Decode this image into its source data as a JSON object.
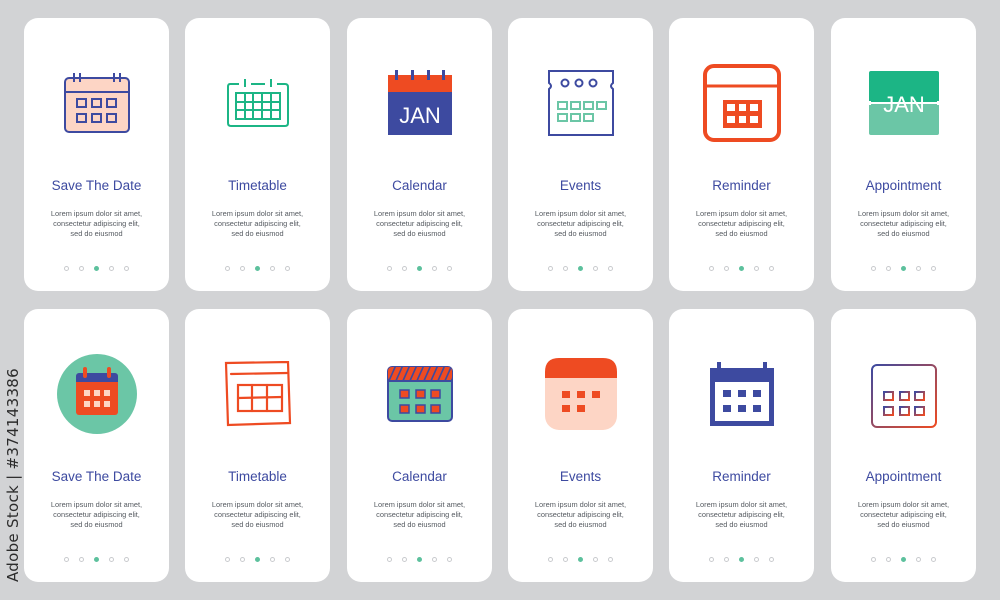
{
  "colors": {
    "background": "#d2d3d5",
    "card": "#ffffff",
    "title": "#3d4aa0",
    "text": "#555a60",
    "dot_active": "#5dc19d",
    "dot_inactive": "#c9cbce",
    "navy": "#3d4aa0",
    "orange": "#ee4b22",
    "green": "#1cb585",
    "mint": "#6bc6a6",
    "peach": "#fdd5c5"
  },
  "watermark": "Adobe Stock | #374143386",
  "description": [
    "Lorem ipsum dolor sit amet,",
    "consectetur adipiscing elit,",
    "sed do eiusmod"
  ],
  "pagination": {
    "total": 5,
    "active_index": 2
  },
  "rows": [
    {
      "cards": [
        {
          "title": "Save The Date",
          "icon": "calendar-outline-peach-icon"
        },
        {
          "title": "Timetable",
          "icon": "timetable-grid-outline-icon"
        },
        {
          "title": "Calendar",
          "icon": "calendar-jan-page-icon",
          "icon_text": "JAN"
        },
        {
          "title": "Events",
          "icon": "event-ticket-calendar-icon"
        },
        {
          "title": "Reminder",
          "icon": "reminder-calendar-outline-icon"
        },
        {
          "title": "Appointment",
          "icon": "flip-calendar-jan-icon",
          "icon_text": "JAN"
        }
      ]
    },
    {
      "cards": [
        {
          "title": "Save The Date",
          "icon": "calendar-circle-badge-icon"
        },
        {
          "title": "Timetable",
          "icon": "sketch-timetable-icon"
        },
        {
          "title": "Calendar",
          "icon": "calendar-striped-header-icon"
        },
        {
          "title": "Events",
          "icon": "calendar-rounded-flat-icon"
        },
        {
          "title": "Reminder",
          "icon": "calendar-solid-icon"
        },
        {
          "title": "Appointment",
          "icon": "calendar-gradient-outline-icon"
        }
      ]
    }
  ]
}
